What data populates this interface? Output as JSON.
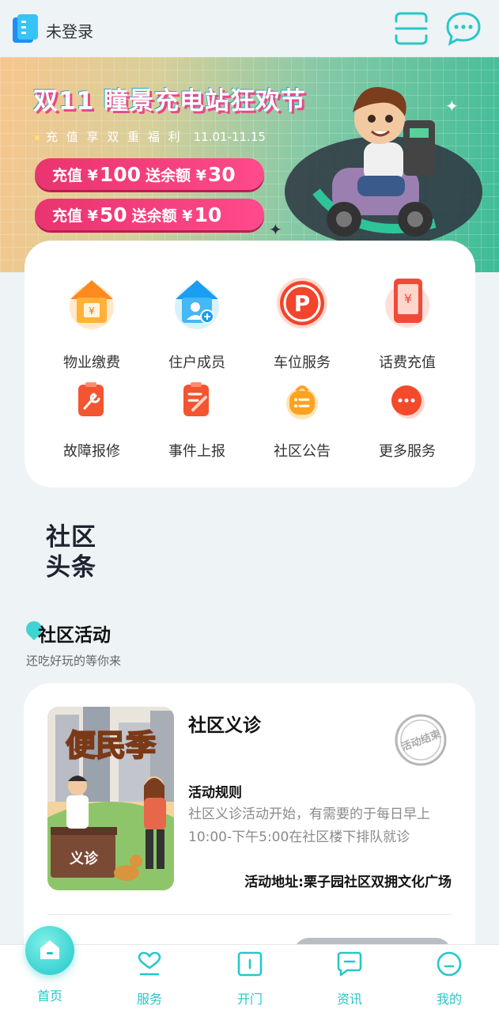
{
  "header": {
    "login_status": "未登录",
    "scan_icon": "scan-icon",
    "message_icon": "chat-bubble-icon"
  },
  "banner": {
    "title": "双11 瞳景充电站狂欢节",
    "subtitle": "充 值 享 双 重 福 利",
    "date_range": "11.01-11.15",
    "offers": [
      {
        "prefix": "充值 ¥",
        "amount": "100",
        "suffix": "送余额 ¥",
        "bonus": "30"
      },
      {
        "prefix": "充值 ¥",
        "amount": "50",
        "suffix": "送余额 ¥",
        "bonus": "10"
      }
    ]
  },
  "services": [
    {
      "label": "物业缴费",
      "icon": "house-payment-icon"
    },
    {
      "label": "住户成员",
      "icon": "add-member-icon"
    },
    {
      "label": "车位服务",
      "icon": "parking-icon"
    },
    {
      "label": "话费充值",
      "icon": "phone-topup-icon"
    },
    {
      "label": "故障报修",
      "icon": "repair-icon"
    },
    {
      "label": "事件上报",
      "icon": "report-icon"
    },
    {
      "label": "社区公告",
      "icon": "announcement-icon"
    },
    {
      "label": "更多服务",
      "icon": "more-icon"
    }
  ],
  "headline": {
    "line1": "社区",
    "line2": "头条"
  },
  "activities_section": {
    "title": "社区活动",
    "subtitle": "还吃好玩的等你来"
  },
  "activity": {
    "poster_text": "便民季",
    "poster_desk_text": "义诊",
    "title": "社区义诊",
    "status_stamp": "活动结束",
    "rule_heading": "活动规则",
    "rule_body": "社区义诊活动开始，有需要的于每日早上10:00-下午5:00在社区楼下排队就诊",
    "address": "活动地址:栗子园社区双拥文化广场"
  },
  "bottom_nav": [
    {
      "label": "首页",
      "icon": "home-icon"
    },
    {
      "label": "服务",
      "icon": "heart-icon"
    },
    {
      "label": "开门",
      "icon": "door-icon"
    },
    {
      "label": "资讯",
      "icon": "news-icon"
    },
    {
      "label": "我的",
      "icon": "profile-icon"
    }
  ],
  "colors": {
    "accent": "#27c7c9",
    "pill": "#e9346f",
    "background": "#eef3f6"
  }
}
